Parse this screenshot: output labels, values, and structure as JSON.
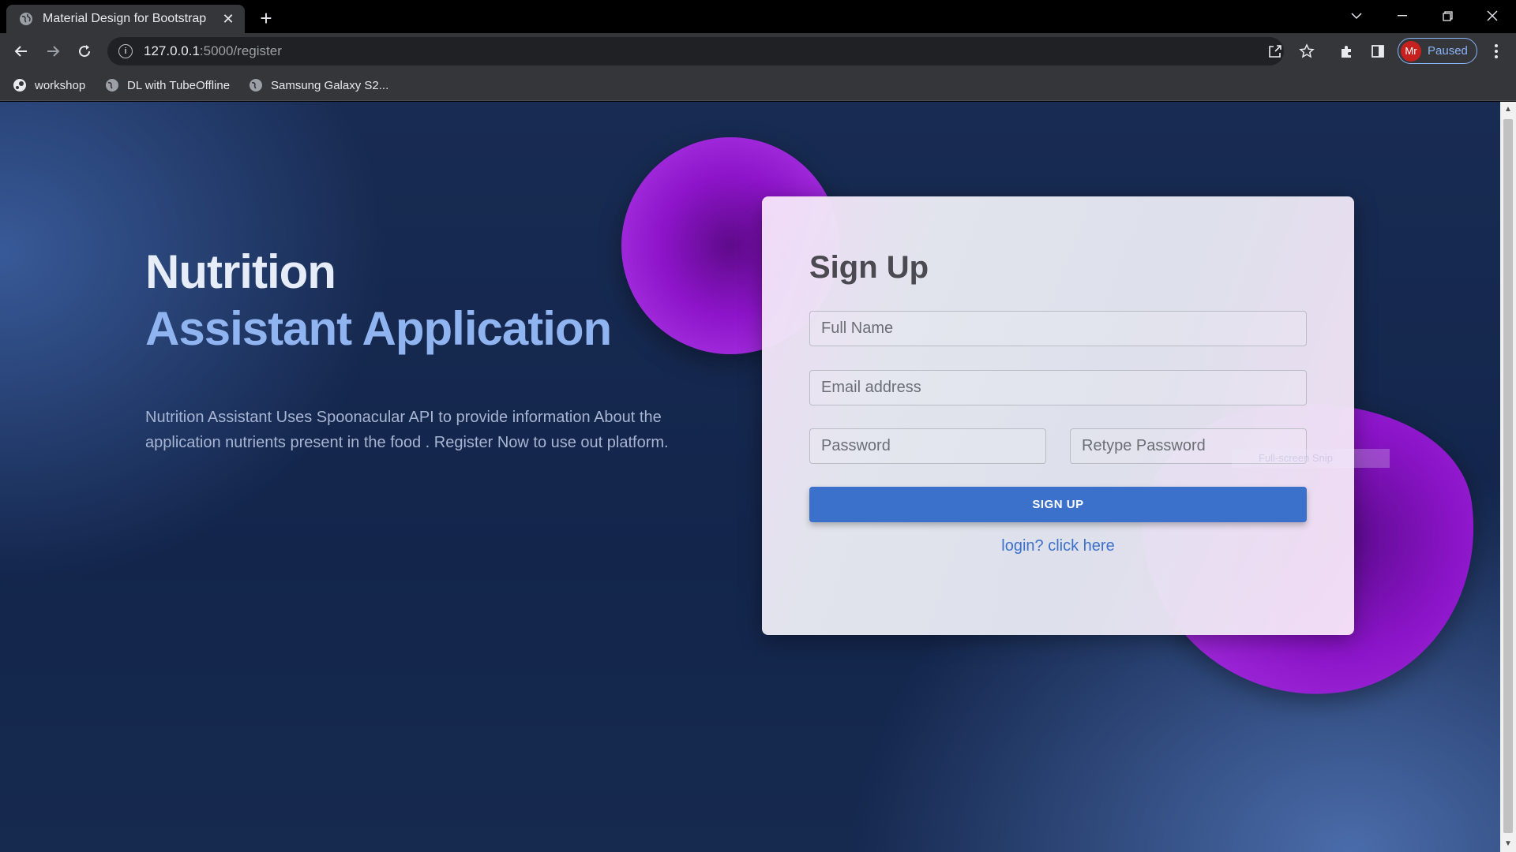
{
  "browser": {
    "tab_title": "Material Design for Bootstrap",
    "tab_close": "✕",
    "new_tab": "+",
    "url_host": "127.0.0.1",
    "url_path": ":5000/register",
    "profile_initials": "Mr",
    "profile_status": "Paused",
    "bookmarks": [
      {
        "label": "workshop"
      },
      {
        "label": "DL with TubeOffline"
      },
      {
        "label": "Samsung Galaxy S2..."
      }
    ]
  },
  "hero": {
    "title_line1": "Nutrition",
    "title_line2": "Assistant Application",
    "description": "Nutrition Assistant Uses Spoonacular API to provide information About the application nutrients present in the food . Register Now to use out platform."
  },
  "signup": {
    "heading": "Sign Up",
    "full_name_placeholder": "Full Name",
    "email_placeholder": "Email address",
    "password_placeholder": "Password",
    "retype_password_placeholder": "Retype Password",
    "submit_label": "SIGN UP",
    "login_link": "login? click here"
  },
  "overlay": {
    "snip_label": "Full-screen Snip"
  },
  "colors": {
    "accent": "#3b71ca",
    "blob": "#8d14c9",
    "profile_avatar": "#c5221f"
  }
}
